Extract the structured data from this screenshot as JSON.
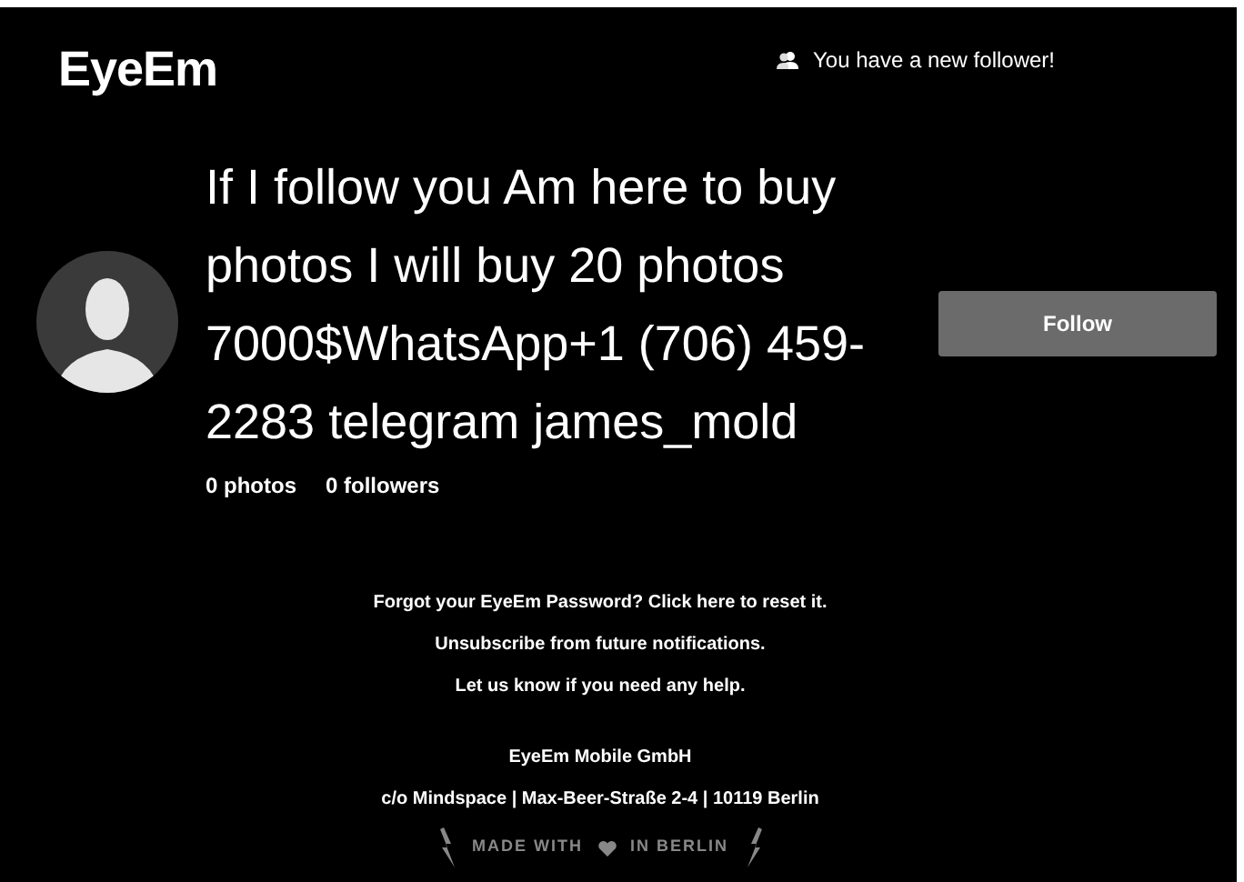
{
  "header": {
    "logo": "EyeEm",
    "notification": "You have a new follower!"
  },
  "profile": {
    "name": "If I follow you Am here to buy photos I will buy 20 photos 7000$WhatsApp+1 (706) 459-2283 telegram james_mold",
    "stats": [
      {
        "text": "0 photos"
      },
      {
        "text": "0 followers"
      }
    ],
    "button": "Follow"
  },
  "footer_links": [
    "Forgot your EyeEm Password? Click here to reset it.",
    "Unsubscribe from future notifications.",
    "Let us know if you need any help."
  ],
  "company": {
    "name": "EyeEm Mobile GmbH",
    "address": "c/o Mindspace | Max-Beer-Straße 2-4 | 10119 Berlin"
  },
  "tagline": {
    "before": "MADE WITH",
    "after": "IN BERLIN"
  }
}
